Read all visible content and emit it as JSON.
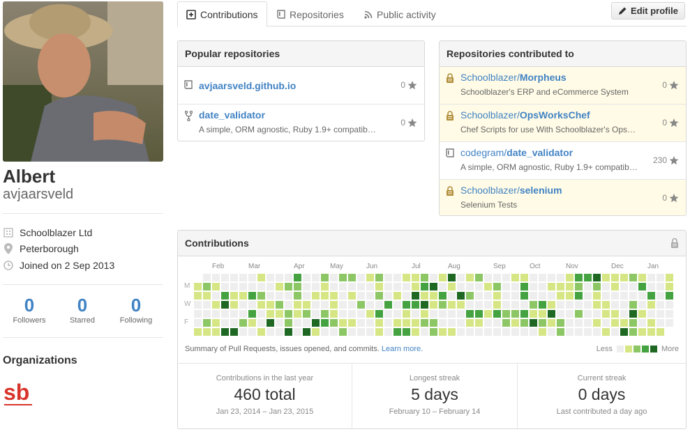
{
  "profile": {
    "fullname": "Albert",
    "username": "avjaarsveld",
    "company": "Schoolblazer Ltd",
    "location": "Peterborough",
    "joined": "Joined on 2 Sep 2013",
    "stats": [
      {
        "value": "0",
        "label": "Followers"
      },
      {
        "value": "0",
        "label": "Starred"
      },
      {
        "value": "0",
        "label": "Following"
      }
    ],
    "organizations_title": "Organizations",
    "org_logo_text": "sb"
  },
  "tabs": [
    {
      "label": "Contributions",
      "icon": "plus-square-icon",
      "active": true
    },
    {
      "label": "Repositories",
      "icon": "repo-book-icon",
      "active": false
    },
    {
      "label": "Public activity",
      "icon": "rss-icon",
      "active": false
    }
  ],
  "edit_profile_label": "Edit profile",
  "popular": {
    "title": "Popular repositories",
    "repos": [
      {
        "name": "avjaarsveld.github.io",
        "desc": "",
        "stars": "0",
        "icon": "repo-icon"
      },
      {
        "name": "date_validator",
        "desc": "A simple, ORM agnostic, Ruby 1.9+ compatib…",
        "stars": "0",
        "icon": "fork-icon"
      }
    ]
  },
  "contributed": {
    "title": "Repositories contributed to",
    "repos": [
      {
        "owner": "Schoolblazer/",
        "name": "Morpheus",
        "desc": "Schoolblazer's ERP and eCommerce System",
        "stars": "0",
        "private": true
      },
      {
        "owner": "Schoolblazer/",
        "name": "OpsWorksChef",
        "desc": "Chef Scripts for use With Schoolblazer's Ops…",
        "stars": "0",
        "private": true
      },
      {
        "owner": "codegram/",
        "name": "date_validator",
        "desc": "A simple, ORM agnostic, Ruby 1.9+ compatib…",
        "stars": "230",
        "private": false
      },
      {
        "owner": "Schoolblazer/",
        "name": "selenium",
        "desc": "Selenium Tests",
        "stars": "0",
        "private": true
      }
    ]
  },
  "contributions": {
    "title": "Contributions",
    "months": [
      "Feb",
      "Mar",
      "Apr",
      "May",
      "Jun",
      "Jul",
      "Aug",
      "Sep",
      "Oct",
      "Nov",
      "Dec",
      "Jan"
    ],
    "days": [
      "M",
      "W",
      "F"
    ],
    "summary": "Summary of Pull Requests, issues opened, and commits.",
    "learn_more": "Learn more.",
    "legend_less": "Less",
    "legend_more": "More",
    "colors": [
      "#eeeeee",
      "#d6e685",
      "#8cc665",
      "#44a340",
      "#1e6823"
    ],
    "streaks": [
      {
        "title": "Contributions in the last year",
        "value": "460 total",
        "dates": "Jan 23, 2014 – Jan 23, 2015"
      },
      {
        "title": "Longest streak",
        "value": "5 days",
        "dates": "February 10 – February 14"
      },
      {
        "title": "Current streak",
        "value": "0 days",
        "dates": "Last contributed a day ago"
      }
    ]
  }
}
